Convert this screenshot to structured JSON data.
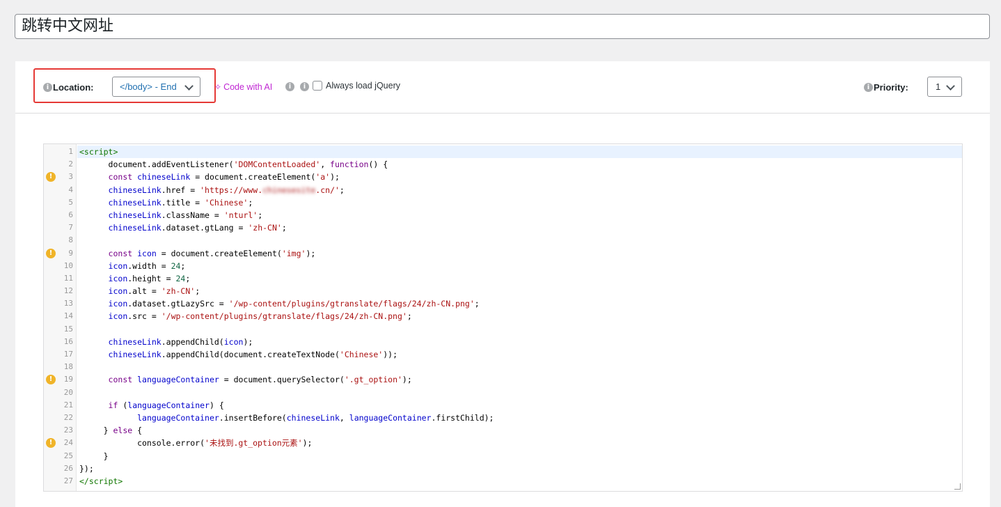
{
  "title": "跳转中文网址",
  "toolbar": {
    "location_label": "Location:",
    "location_value": "</body> - End",
    "code_with_ai": "Code with AI",
    "always_load_jquery": "Always load jQuery",
    "priority_label": "Priority:",
    "priority_value": "1"
  },
  "colors": {
    "accent": "#2271b1",
    "ai": "#c026d3",
    "highlight_box": "#e53935",
    "warning": "#f0b429"
  },
  "editor": {
    "lines": [
      {
        "n": "1",
        "warn": false,
        "active": true,
        "html": "<span class=\"tag\">&lt;script&gt;</span>"
      },
      {
        "n": "2",
        "warn": false,
        "html": "      document.addEventListener(<span class=\"str\">'DOMContentLoaded'</span>, <span class=\"kw\">function</span>() {"
      },
      {
        "n": "3",
        "warn": true,
        "html": "      <span class=\"kw\">const</span> <span class=\"var\">chineseLink</span> = document.createElement(<span class=\"str\">'a'</span>);"
      },
      {
        "n": "4",
        "warn": false,
        "html": "      <span class=\"var\">chineseLink</span>.href = <span class=\"str\">'https://www.</span><span class=\"blurred\">chinesesite</span><span class=\"str\">.cn/'</span>;"
      },
      {
        "n": "5",
        "warn": false,
        "html": "      <span class=\"var\">chineseLink</span>.title = <span class=\"str\">'Chinese'</span>;"
      },
      {
        "n": "6",
        "warn": false,
        "html": "      <span class=\"var\">chineseLink</span>.className = <span class=\"str\">'nturl'</span>;"
      },
      {
        "n": "7",
        "warn": false,
        "html": "      <span class=\"var\">chineseLink</span>.dataset.gtLang = <span class=\"str\">'zh-CN'</span>;"
      },
      {
        "n": "8",
        "warn": false,
        "html": ""
      },
      {
        "n": "9",
        "warn": true,
        "html": "      <span class=\"kw\">const</span> <span class=\"var\">icon</span> = document.createElement(<span class=\"str\">'img'</span>);"
      },
      {
        "n": "10",
        "warn": false,
        "html": "      <span class=\"var\">icon</span>.width = <span class=\"num\">24</span>;"
      },
      {
        "n": "11",
        "warn": false,
        "html": "      <span class=\"var\">icon</span>.height = <span class=\"num\">24</span>;"
      },
      {
        "n": "12",
        "warn": false,
        "html": "      <span class=\"var\">icon</span>.alt = <span class=\"str\">'zh-CN'</span>;"
      },
      {
        "n": "13",
        "warn": false,
        "html": "      <span class=\"var\">icon</span>.dataset.gtLazySrc = <span class=\"str\">'/wp-content/plugins/gtranslate/flags/24/zh-CN.png'</span>;"
      },
      {
        "n": "14",
        "warn": false,
        "html": "      <span class=\"var\">icon</span>.src = <span class=\"str\">'/wp-content/plugins/gtranslate/flags/24/zh-CN.png'</span>;"
      },
      {
        "n": "15",
        "warn": false,
        "html": ""
      },
      {
        "n": "16",
        "warn": false,
        "html": "      <span class=\"var\">chineseLink</span>.appendChild(<span class=\"var\">icon</span>);"
      },
      {
        "n": "17",
        "warn": false,
        "html": "      <span class=\"var\">chineseLink</span>.appendChild(document.createTextNode(<span class=\"str\">'Chinese'</span>));"
      },
      {
        "n": "18",
        "warn": false,
        "html": ""
      },
      {
        "n": "19",
        "warn": true,
        "html": "      <span class=\"kw\">const</span> <span class=\"var\">languageContainer</span> = document.querySelector(<span class=\"str\">'.gt_option'</span>);"
      },
      {
        "n": "20",
        "warn": false,
        "html": ""
      },
      {
        "n": "21",
        "warn": false,
        "html": "      <span class=\"kw\">if</span> (<span class=\"var\">languageContainer</span>) {"
      },
      {
        "n": "22",
        "warn": false,
        "html": "            <span class=\"var\">languageContainer</span>.insertBefore(<span class=\"var\">chineseLink</span>, <span class=\"var\">languageContainer</span>.firstChild);"
      },
      {
        "n": "23",
        "warn": false,
        "html": "     } <span class=\"kw\">else</span> {"
      },
      {
        "n": "24",
        "warn": true,
        "html": "            console.error(<span class=\"str\">'未找到.gt_option元素'</span>);"
      },
      {
        "n": "25",
        "warn": false,
        "html": "     }"
      },
      {
        "n": "26",
        "warn": false,
        "html": "});"
      },
      {
        "n": "27",
        "warn": false,
        "html": "<span class=\"tag\">&lt;/script&gt;</span>"
      }
    ]
  }
}
